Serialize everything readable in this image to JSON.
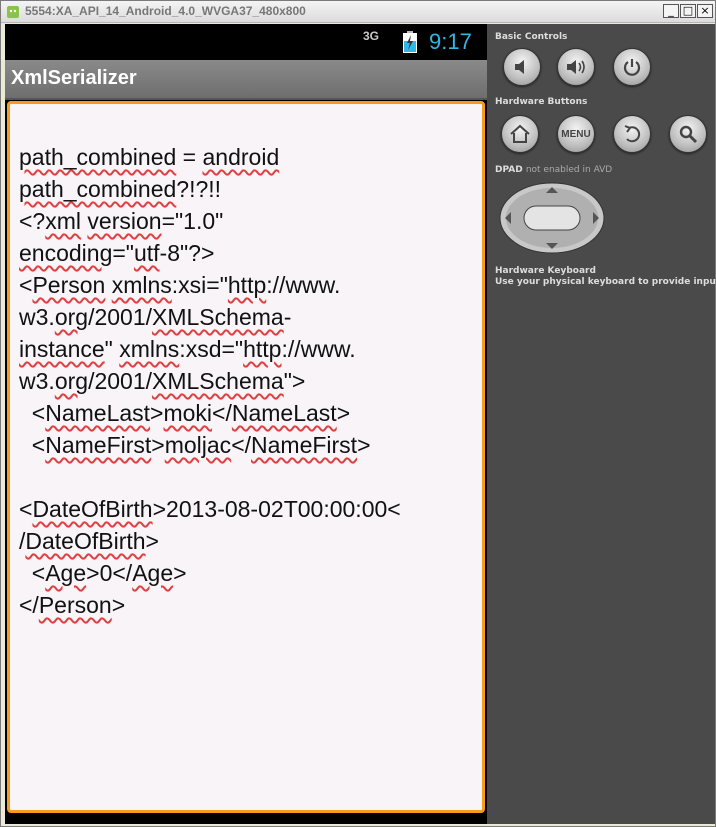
{
  "window": {
    "title": "5554:XA_API_14_Android_4.0_WVGA37_480x800"
  },
  "status": {
    "signal": "3G",
    "time": "9:17"
  },
  "app": {
    "title": "XmlSerializer"
  },
  "content_lines": [
    "path_combined = android",
    "path_combined?!?!!",
    "<?xml version=\"1.0\"",
    "encoding=\"utf-8\"?>",
    "<Person xmlns:xsi=\"http://www.",
    "w3.org/2001/XMLSchema-",
    "instance\" xmlns:xsd=\"http://www.",
    "w3.org/2001/XMLSchema\">",
    "  <NameLast>moki</NameLast>",
    "  <NameFirst>moljac</NameFirst>",
    "",
    "<DateOfBirth>2013-08-02T00:00:00<",
    "/DateOfBirth>",
    "  <Age>0</Age>",
    "</Person>"
  ],
  "panel": {
    "basic_controls_label": "Basic Controls",
    "hardware_buttons_label": "Hardware Buttons",
    "menu_label": "MENU",
    "dpad_label": "DPAD",
    "dpad_note": "not enabled in AVD",
    "keyboard_label": "Hardware Keyboard",
    "keyboard_note": "Use your physical keyboard to provide input"
  },
  "icons": {
    "volume_down": "volume-down-icon",
    "volume_up": "volume-up-icon",
    "power": "power-icon",
    "home": "home-icon",
    "back": "back-icon",
    "search": "search-icon"
  }
}
